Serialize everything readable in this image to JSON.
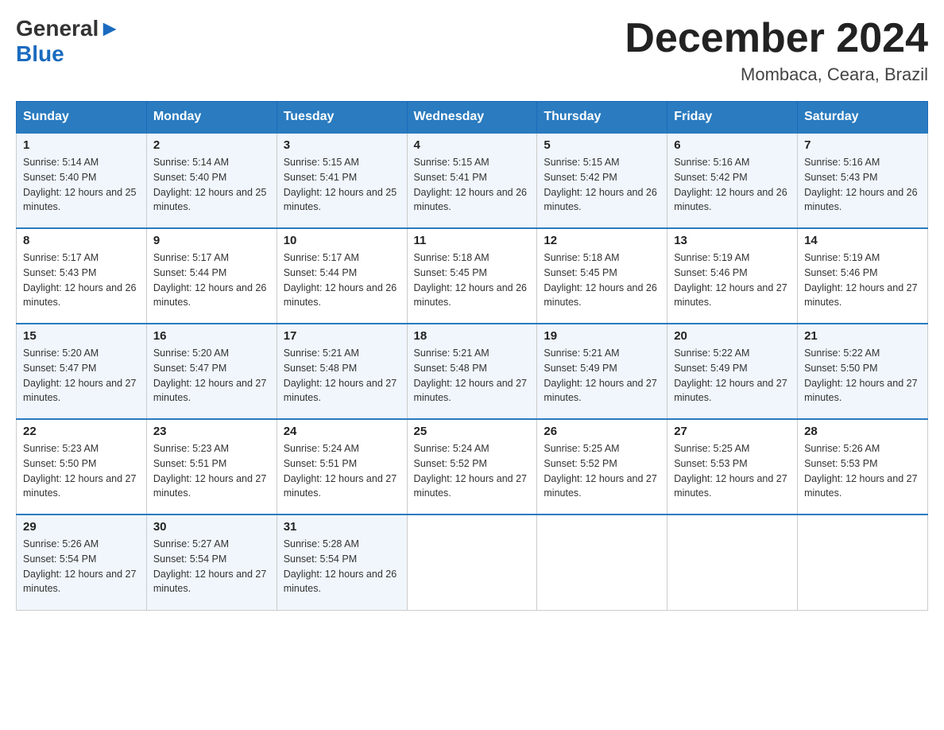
{
  "header": {
    "logo": {
      "text_general": "General",
      "text_blue": "Blue",
      "arrow_icon": "arrow-icon"
    },
    "title": "December 2024",
    "location": "Mombaca, Ceara, Brazil"
  },
  "days_of_week": [
    "Sunday",
    "Monday",
    "Tuesday",
    "Wednesday",
    "Thursday",
    "Friday",
    "Saturday"
  ],
  "weeks": [
    [
      {
        "day": "1",
        "sunrise": "5:14 AM",
        "sunset": "5:40 PM",
        "daylight": "12 hours and 25 minutes."
      },
      {
        "day": "2",
        "sunrise": "5:14 AM",
        "sunset": "5:40 PM",
        "daylight": "12 hours and 25 minutes."
      },
      {
        "day": "3",
        "sunrise": "5:15 AM",
        "sunset": "5:41 PM",
        "daylight": "12 hours and 25 minutes."
      },
      {
        "day": "4",
        "sunrise": "5:15 AM",
        "sunset": "5:41 PM",
        "daylight": "12 hours and 26 minutes."
      },
      {
        "day": "5",
        "sunrise": "5:15 AM",
        "sunset": "5:42 PM",
        "daylight": "12 hours and 26 minutes."
      },
      {
        "day": "6",
        "sunrise": "5:16 AM",
        "sunset": "5:42 PM",
        "daylight": "12 hours and 26 minutes."
      },
      {
        "day": "7",
        "sunrise": "5:16 AM",
        "sunset": "5:43 PM",
        "daylight": "12 hours and 26 minutes."
      }
    ],
    [
      {
        "day": "8",
        "sunrise": "5:17 AM",
        "sunset": "5:43 PM",
        "daylight": "12 hours and 26 minutes."
      },
      {
        "day": "9",
        "sunrise": "5:17 AM",
        "sunset": "5:44 PM",
        "daylight": "12 hours and 26 minutes."
      },
      {
        "day": "10",
        "sunrise": "5:17 AM",
        "sunset": "5:44 PM",
        "daylight": "12 hours and 26 minutes."
      },
      {
        "day": "11",
        "sunrise": "5:18 AM",
        "sunset": "5:45 PM",
        "daylight": "12 hours and 26 minutes."
      },
      {
        "day": "12",
        "sunrise": "5:18 AM",
        "sunset": "5:45 PM",
        "daylight": "12 hours and 26 minutes."
      },
      {
        "day": "13",
        "sunrise": "5:19 AM",
        "sunset": "5:46 PM",
        "daylight": "12 hours and 27 minutes."
      },
      {
        "day": "14",
        "sunrise": "5:19 AM",
        "sunset": "5:46 PM",
        "daylight": "12 hours and 27 minutes."
      }
    ],
    [
      {
        "day": "15",
        "sunrise": "5:20 AM",
        "sunset": "5:47 PM",
        "daylight": "12 hours and 27 minutes."
      },
      {
        "day": "16",
        "sunrise": "5:20 AM",
        "sunset": "5:47 PM",
        "daylight": "12 hours and 27 minutes."
      },
      {
        "day": "17",
        "sunrise": "5:21 AM",
        "sunset": "5:48 PM",
        "daylight": "12 hours and 27 minutes."
      },
      {
        "day": "18",
        "sunrise": "5:21 AM",
        "sunset": "5:48 PM",
        "daylight": "12 hours and 27 minutes."
      },
      {
        "day": "19",
        "sunrise": "5:21 AM",
        "sunset": "5:49 PM",
        "daylight": "12 hours and 27 minutes."
      },
      {
        "day": "20",
        "sunrise": "5:22 AM",
        "sunset": "5:49 PM",
        "daylight": "12 hours and 27 minutes."
      },
      {
        "day": "21",
        "sunrise": "5:22 AM",
        "sunset": "5:50 PM",
        "daylight": "12 hours and 27 minutes."
      }
    ],
    [
      {
        "day": "22",
        "sunrise": "5:23 AM",
        "sunset": "5:50 PM",
        "daylight": "12 hours and 27 minutes."
      },
      {
        "day": "23",
        "sunrise": "5:23 AM",
        "sunset": "5:51 PM",
        "daylight": "12 hours and 27 minutes."
      },
      {
        "day": "24",
        "sunrise": "5:24 AM",
        "sunset": "5:51 PM",
        "daylight": "12 hours and 27 minutes."
      },
      {
        "day": "25",
        "sunrise": "5:24 AM",
        "sunset": "5:52 PM",
        "daylight": "12 hours and 27 minutes."
      },
      {
        "day": "26",
        "sunrise": "5:25 AM",
        "sunset": "5:52 PM",
        "daylight": "12 hours and 27 minutes."
      },
      {
        "day": "27",
        "sunrise": "5:25 AM",
        "sunset": "5:53 PM",
        "daylight": "12 hours and 27 minutes."
      },
      {
        "day": "28",
        "sunrise": "5:26 AM",
        "sunset": "5:53 PM",
        "daylight": "12 hours and 27 minutes."
      }
    ],
    [
      {
        "day": "29",
        "sunrise": "5:26 AM",
        "sunset": "5:54 PM",
        "daylight": "12 hours and 27 minutes."
      },
      {
        "day": "30",
        "sunrise": "5:27 AM",
        "sunset": "5:54 PM",
        "daylight": "12 hours and 27 minutes."
      },
      {
        "day": "31",
        "sunrise": "5:28 AM",
        "sunset": "5:54 PM",
        "daylight": "12 hours and 26 minutes."
      },
      null,
      null,
      null,
      null
    ]
  ]
}
